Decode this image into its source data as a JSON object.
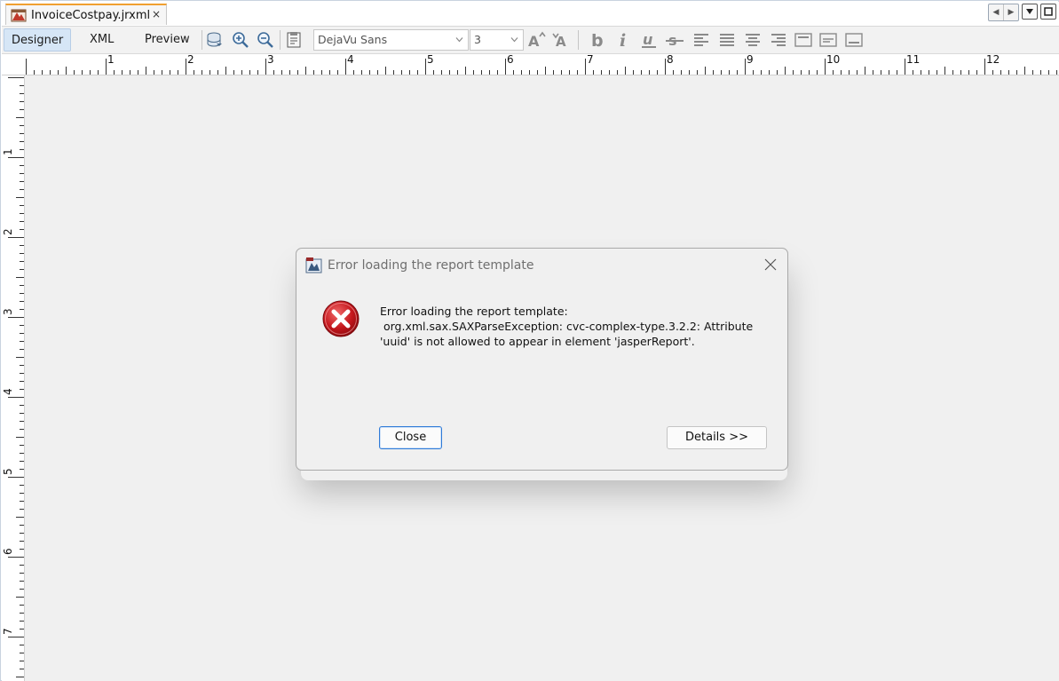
{
  "tab": {
    "title": "InvoiceCostpay.jrxml",
    "close_glyph": "×"
  },
  "toolbar": {
    "views": [
      {
        "label": "Designer",
        "active": true
      },
      {
        "label": "XML",
        "active": false
      },
      {
        "label": "Preview",
        "active": false
      }
    ],
    "font_name": "DejaVu Sans",
    "font_size": "3"
  },
  "ruler": {
    "h_labels": [
      "1",
      "2",
      "3",
      "4",
      "5",
      "6",
      "7",
      "8",
      "9",
      "10",
      "11",
      "12"
    ],
    "v_labels": [
      "1",
      "2",
      "3",
      "4",
      "5",
      "6",
      "7"
    ]
  },
  "dialog": {
    "title": "Error loading the report template",
    "message_lines": [
      "Error loading the report template:",
      " org.xml.sax.SAXParseException: cvc-complex-type.3.2.2: Attribute",
      "'uuid' is not allowed to appear in element 'jasperReport'."
    ],
    "close_label": "Close",
    "details_label": "Details >>"
  },
  "colors": {
    "accent": "#2f7bd8",
    "error_red": "#c4161c",
    "tab_highlight": "#f0a030",
    "canvas": "#f0f0f0"
  }
}
